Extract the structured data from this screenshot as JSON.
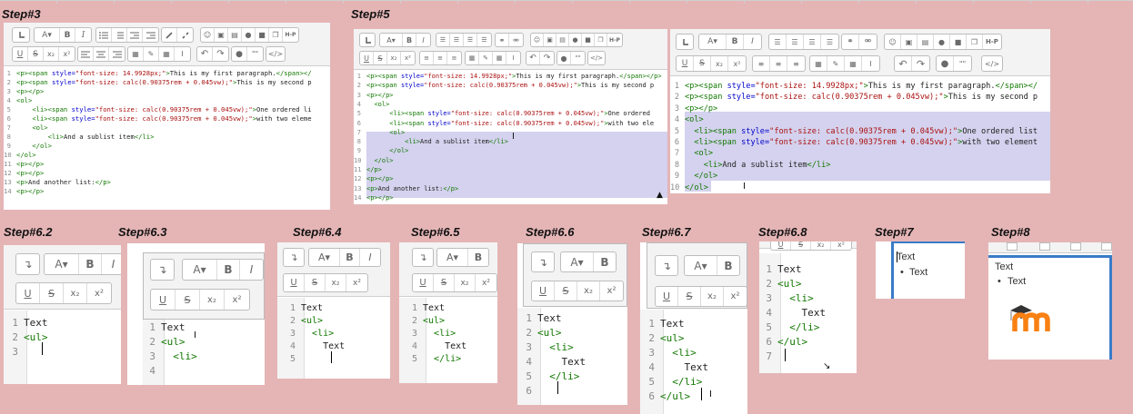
{
  "steps": {
    "s3": "Step#3",
    "s5": "Step#5",
    "s62": "Step#6.2",
    "s63": "Step#6.3",
    "s64": "Step#6.4",
    "s65": "Step#6.5",
    "s66": "Step#6.6",
    "s67": "Step#6.7",
    "s68": "Step#6.8",
    "s7": "Step#7",
    "s8": "Step#8"
  },
  "toolbar": {
    "para": "A",
    "bold": "B",
    "italic": "I",
    "underline": "U",
    "strike": "S",
    "sub": "x₂",
    "sup": "x²",
    "h5p": "H-P",
    "quote": "\"\"",
    "html": "</>"
  },
  "text": {
    "text": "Text"
  },
  "colors": {
    "background": "#e5b5b6",
    "tag": "#117700",
    "attr": "#0000cc",
    "string": "#aa1111",
    "selection": "#d4d2ee",
    "frame_blue": "#3a7bc8",
    "logo_orange": "#f98012"
  },
  "icons": [
    "undo-icon",
    "paragraph-icon",
    "bold-icon",
    "italic-icon",
    "unordered-list-icon",
    "ordered-list-icon",
    "outdent-icon",
    "indent-icon",
    "link-icon",
    "unlink-icon",
    "emoji-icon",
    "image-icon",
    "media-icon",
    "record-audio-icon",
    "record-video-icon",
    "manage-files-icon",
    "h5p-icon",
    "underline-icon",
    "strikethrough-icon",
    "subscript-icon",
    "superscript-icon",
    "align-left-icon",
    "align-center-icon",
    "align-right-icon",
    "equation-icon",
    "special-char-icon",
    "table-icon",
    "clear-format-icon",
    "redo-icon",
    "accessibility-checker-icon",
    "screenreader-helper-icon",
    "html-icon",
    "moodle-logo"
  ],
  "code3": [
    [
      [
        "t",
        "<p><span "
      ],
      [
        "a",
        "style="
      ],
      [
        "s",
        "\"font-size: 14.9928px;\""
      ],
      [
        "t",
        ">"
      ],
      [
        "p",
        "This is my first paragraph."
      ],
      [
        "t",
        "</span></"
      ]
    ],
    [
      [
        "t",
        "<p><span "
      ],
      [
        "a",
        "style="
      ],
      [
        "s",
        "\"font-size: calc(0.90375rem + 0.045vw);\""
      ],
      [
        "t",
        ">"
      ],
      [
        "p",
        "This is my second p"
      ]
    ],
    [
      [
        "t",
        "<p></p>"
      ]
    ],
    [
      [
        "t",
        "<ol>"
      ]
    ],
    [
      [
        "p",
        "    "
      ],
      [
        "t",
        "<li><span "
      ],
      [
        "a",
        "style="
      ],
      [
        "s",
        "\"font-size: calc(0.90375rem + 0.045vw);\""
      ],
      [
        "t",
        ">"
      ],
      [
        "p",
        "One ordered li"
      ]
    ],
    [
      [
        "p",
        "    "
      ],
      [
        "t",
        "<li><span "
      ],
      [
        "a",
        "style="
      ],
      [
        "s",
        "\"font-size: calc(0.90375rem + 0.045vw);\""
      ],
      [
        "t",
        ">"
      ],
      [
        "p",
        "with two eleme"
      ]
    ],
    [
      [
        "p",
        "    "
      ],
      [
        "t",
        "<ol>"
      ]
    ],
    [
      [
        "p",
        "        "
      ],
      [
        "t",
        "<li>"
      ],
      [
        "p",
        "And a sublist item"
      ],
      [
        "t",
        "</li>"
      ]
    ],
    [
      [
        "p",
        "    "
      ],
      [
        "t",
        "</ol>"
      ]
    ],
    [
      [
        "t",
        "</ol>"
      ]
    ],
    [
      [
        "t",
        "<p></p>"
      ]
    ],
    [
      [
        "t",
        "<p></p>"
      ]
    ],
    [
      [
        "t",
        "<p>"
      ],
      [
        "p",
        "And another list:"
      ],
      [
        "t",
        "</p>"
      ]
    ],
    [
      [
        "t",
        "<p></p>"
      ]
    ]
  ],
  "code5a": [
    [
      [
        "t",
        "<p><span "
      ],
      [
        "a",
        "style="
      ],
      [
        "s",
        "\"font-size: 14.9928px;\""
      ],
      [
        "t",
        ">"
      ],
      [
        "p",
        "This is my first paragraph."
      ],
      [
        "t",
        "</span></p>"
      ]
    ],
    [
      [
        "t",
        "<p><span "
      ],
      [
        "a",
        "style="
      ],
      [
        "s",
        "\"font-size: calc(0.90375rem + 0.045vw);\""
      ],
      [
        "t",
        ">"
      ],
      [
        "p",
        "This is my second p"
      ]
    ],
    [
      [
        "t",
        "<p></p>"
      ]
    ],
    [
      [
        "p",
        "  "
      ],
      [
        "t",
        "<ol>"
      ]
    ],
    [
      [
        "p",
        "      "
      ],
      [
        "t",
        "<li><span "
      ],
      [
        "a",
        "style="
      ],
      [
        "s",
        "\"font-size: calc(0.90375rem + 0.045vw);\""
      ],
      [
        "t",
        ">"
      ],
      [
        "p",
        "One ordered"
      ]
    ],
    [
      [
        "p",
        "      "
      ],
      [
        "t",
        "<li><span "
      ],
      [
        "a",
        "style="
      ],
      [
        "s",
        "\"font-size: calc(0.90375rem + 0.045vw);\""
      ],
      [
        "t",
        ">"
      ],
      [
        "p",
        "with two ele"
      ]
    ],
    [
      [
        "p",
        "      "
      ],
      [
        "t",
        "<ol>"
      ]
    ],
    [
      [
        "p",
        "          "
      ],
      [
        "t",
        "<li>"
      ],
      [
        "p",
        "And a sublist item"
      ],
      [
        "t",
        "</li>"
      ]
    ],
    [
      [
        "p",
        "      "
      ],
      [
        "t",
        "</ol>"
      ]
    ],
    [
      [
        "p",
        "  "
      ],
      [
        "t",
        "</ol>"
      ]
    ],
    [
      [
        "t",
        "</p>"
      ]
    ],
    [
      [
        "t",
        "<p></p>"
      ]
    ],
    [
      [
        "t",
        "<p>"
      ],
      [
        "p",
        "And another list:"
      ],
      [
        "t",
        "</p>"
      ]
    ],
    [
      [
        "t",
        "<p></p>"
      ]
    ]
  ],
  "code5b": [
    [
      [
        "t",
        "<p><span "
      ],
      [
        "a",
        "style="
      ],
      [
        "s",
        "\"font-size: 14.9928px;\""
      ],
      [
        "t",
        ">"
      ],
      [
        "p",
        "This is my first paragraph."
      ],
      [
        "t",
        "</span></"
      ]
    ],
    [
      [
        "t",
        "<p><span "
      ],
      [
        "a",
        "style="
      ],
      [
        "s",
        "\"font-size: calc(0.90375rem + 0.045vw);\""
      ],
      [
        "t",
        ">"
      ],
      [
        "p",
        "This is my second p"
      ]
    ],
    [
      [
        "t",
        "<p></p>"
      ]
    ],
    [
      [
        "t",
        "<ol>"
      ]
    ],
    [
      [
        "p",
        "  "
      ],
      [
        "t",
        "<li><span "
      ],
      [
        "a",
        "style="
      ],
      [
        "s",
        "\"font-size: calc(0.90375rem + 0.045vw);\""
      ],
      [
        "t",
        ">"
      ],
      [
        "p",
        "One ordered list"
      ]
    ],
    [
      [
        "p",
        "  "
      ],
      [
        "t",
        "<li><span "
      ],
      [
        "a",
        "style="
      ],
      [
        "s",
        "\"font-size: calc(0.90375rem + 0.045vw);\""
      ],
      [
        "t",
        ">"
      ],
      [
        "p",
        "with two element"
      ]
    ],
    [
      [
        "p",
        "  "
      ],
      [
        "t",
        "<ol>"
      ]
    ],
    [
      [
        "p",
        "    "
      ],
      [
        "t",
        "<li>"
      ],
      [
        "p",
        "And a sublist item"
      ],
      [
        "t",
        "</li>"
      ]
    ],
    [
      [
        "p",
        "  "
      ],
      [
        "t",
        "</ol>"
      ]
    ],
    [
      [
        "t",
        "</ol>"
      ]
    ]
  ],
  "code62": [
    [
      [
        "p",
        "Text"
      ]
    ],
    [
      [
        "t",
        "<ul>"
      ]
    ],
    [
      [
        "p",
        ""
      ]
    ]
  ],
  "code63": [
    [
      [
        "p",
        "Text"
      ]
    ],
    [
      [
        "t",
        "<ul>"
      ]
    ],
    [
      [
        "p",
        "  "
      ],
      [
        "t",
        "<li>"
      ]
    ],
    [
      [
        "p",
        ""
      ]
    ]
  ],
  "code64": [
    [
      [
        "p",
        "Text"
      ]
    ],
    [
      [
        "t",
        "<ul>"
      ]
    ],
    [
      [
        "p",
        "  "
      ],
      [
        "t",
        "<li>"
      ]
    ],
    [
      [
        "p",
        "    Text"
      ]
    ],
    [
      [
        "p",
        ""
      ]
    ]
  ],
  "code65": [
    [
      [
        "p",
        "Text"
      ]
    ],
    [
      [
        "t",
        "<ul>"
      ]
    ],
    [
      [
        "p",
        "  "
      ],
      [
        "t",
        "<li>"
      ]
    ],
    [
      [
        "p",
        "    Text"
      ]
    ],
    [
      [
        "p",
        "  "
      ],
      [
        "t",
        "</li>"
      ]
    ]
  ],
  "code66": [
    [
      [
        "p",
        "Text"
      ]
    ],
    [
      [
        "t",
        "<ul>"
      ]
    ],
    [
      [
        "p",
        "  "
      ],
      [
        "t",
        "<li>"
      ]
    ],
    [
      [
        "p",
        "    Text"
      ]
    ],
    [
      [
        "p",
        "  "
      ],
      [
        "t",
        "</li>"
      ]
    ],
    [
      [
        "p",
        ""
      ]
    ]
  ],
  "code67": [
    [
      [
        "p",
        "Text"
      ]
    ],
    [
      [
        "t",
        "<ul>"
      ]
    ],
    [
      [
        "p",
        "  "
      ],
      [
        "t",
        "<li>"
      ]
    ],
    [
      [
        "p",
        "    Text"
      ]
    ],
    [
      [
        "p",
        "  "
      ],
      [
        "t",
        "</li>"
      ]
    ],
    [
      [
        "t",
        "</ul>"
      ]
    ]
  ],
  "code68": [
    [
      [
        "p",
        "Text"
      ]
    ],
    [
      [
        "t",
        "<ul>"
      ]
    ],
    [
      [
        "p",
        "  "
      ],
      [
        "t",
        "<li>"
      ]
    ],
    [
      [
        "p",
        "    Text"
      ]
    ],
    [
      [
        "p",
        "  "
      ],
      [
        "t",
        "</li>"
      ]
    ],
    [
      [
        "t",
        "</ul>"
      ]
    ],
    [
      [
        "p",
        ""
      ]
    ]
  ]
}
